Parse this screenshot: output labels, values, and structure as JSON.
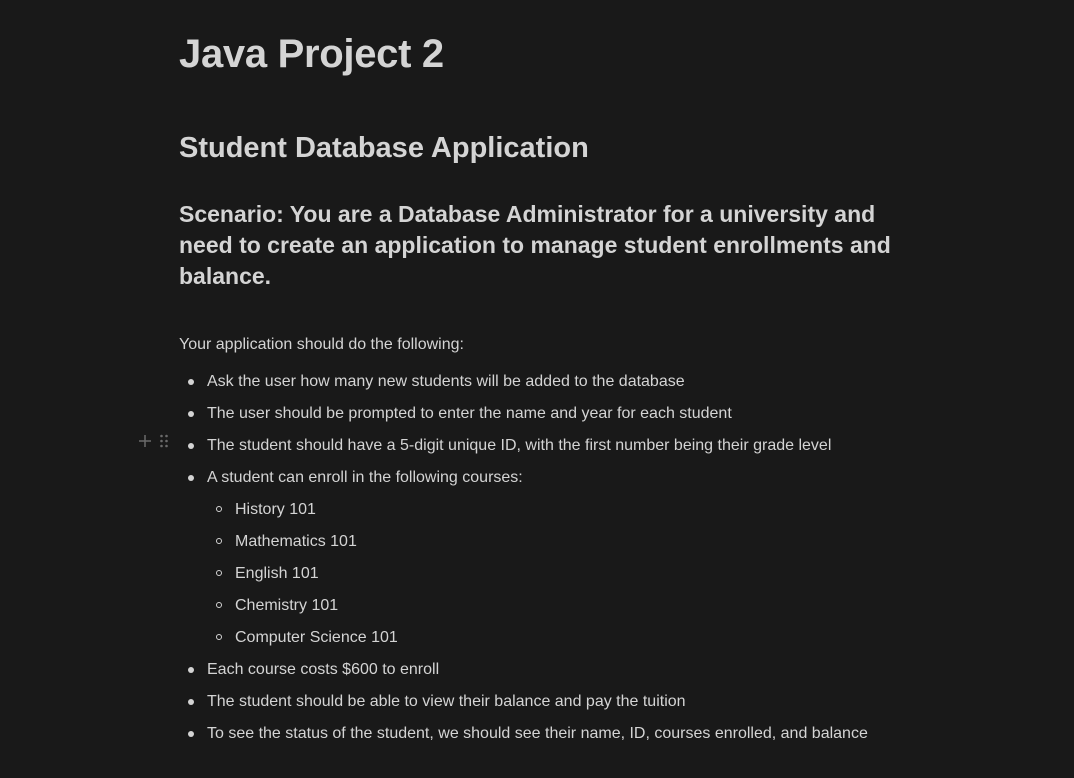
{
  "page": {
    "title": "Java Project 2",
    "heading": "Student Database Application",
    "scenario": "Scenario: You are a Database Administrator for a university and need to create an application to manage student enrollments and balance.",
    "intro": "Your application should do the following:",
    "items": [
      "Ask the user how many new students will be added to the database",
      "The user should be prompted to enter the name and year for each student",
      "The student should have a 5-digit unique ID, with the first number being their grade level",
      "A student can enroll in the following courses:",
      "Each course costs $600 to enroll",
      "The student should be able to view their balance and pay the tuition",
      "To see the status of the student, we should see their name, ID, courses enrolled, and balance"
    ],
    "courses": [
      "History 101",
      "Mathematics 101",
      "English 101",
      "Chemistry 101",
      "Computer Science 101"
    ]
  },
  "icons": {
    "add_block": "plus-icon",
    "drag_handle": "drag-handle-icon"
  },
  "colors": {
    "background": "#191919",
    "text": "#d4d4d4",
    "handle": "#6b6b6b"
  }
}
